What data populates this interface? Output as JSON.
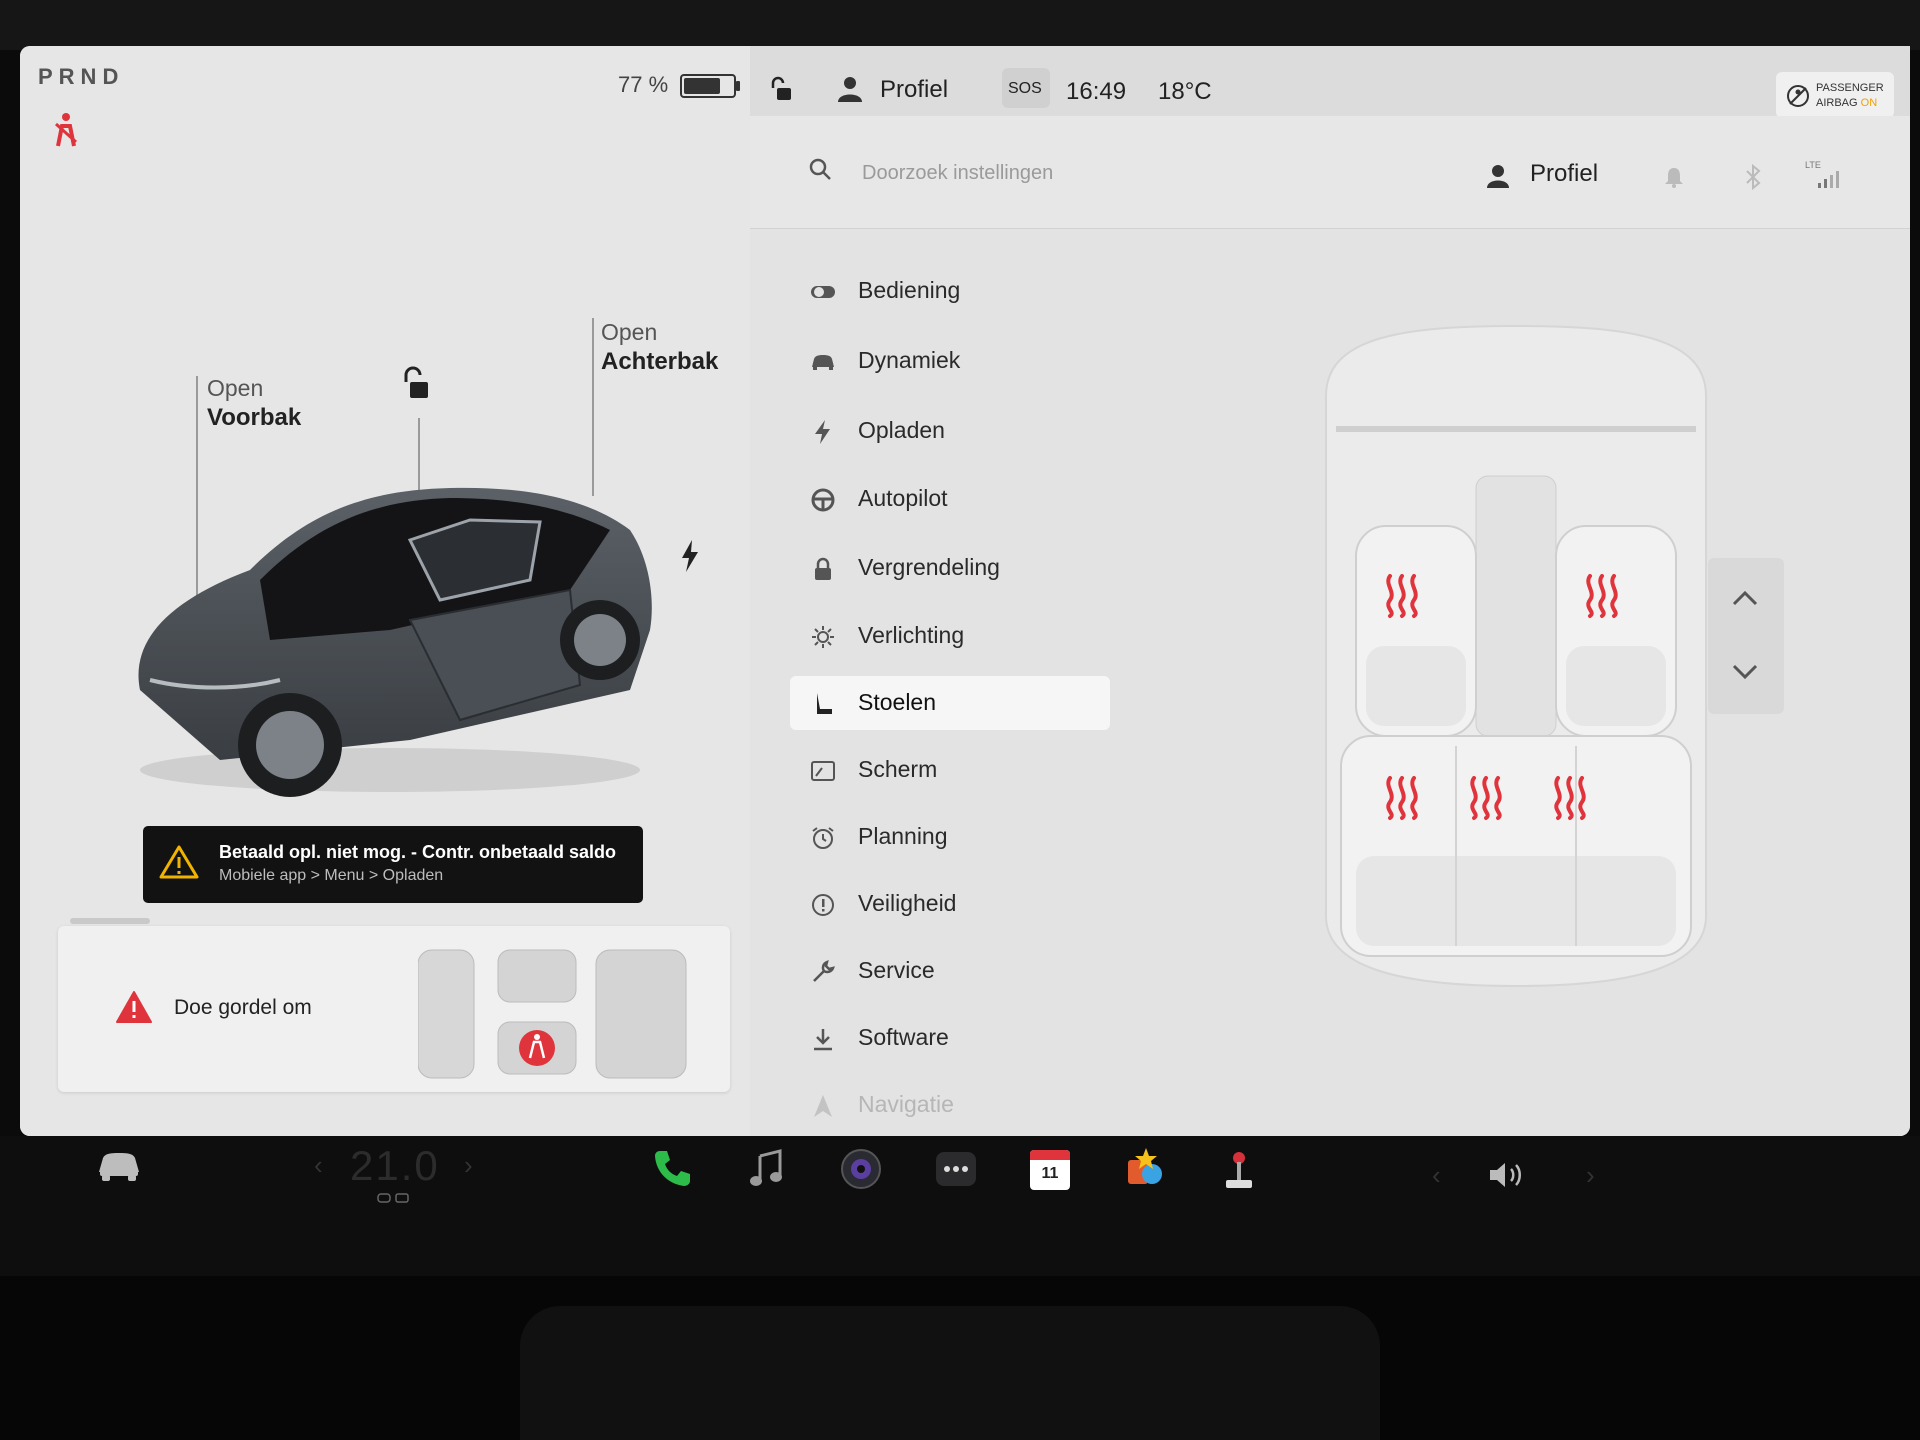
{
  "left": {
    "gear": "PRND",
    "battery": {
      "percent_text": "77 %",
      "level": 0.77
    },
    "frunk": {
      "action": "Open",
      "name": "Voorbak"
    },
    "trunk": {
      "action": "Open",
      "name": "Achterbak"
    },
    "alert": {
      "line1": "Betaald opl. niet mog. - Contr. onbetaald saldo",
      "line2": "Mobiele app > Menu > Opladen"
    },
    "belt_card": {
      "text": "Doe gordel om"
    }
  },
  "statusbar": {
    "profile": "Profiel",
    "sos": "SOS",
    "time": "16:49",
    "temperature": "18°C",
    "airbag_line1": "PASSENGER",
    "airbag_line2": "AIRBAG",
    "airbag_state": "ON"
  },
  "settings": {
    "search_placeholder": "Doorzoek instellingen",
    "profile": "Profiel",
    "lte": "LTE",
    "menu": [
      {
        "label": "Bediening",
        "icon": "toggle-icon"
      },
      {
        "label": "Dynamiek",
        "icon": "car-icon"
      },
      {
        "label": "Opladen",
        "icon": "bolt-icon"
      },
      {
        "label": "Autopilot",
        "icon": "steering-wheel-icon"
      },
      {
        "label": "Vergrendeling",
        "icon": "lock-icon"
      },
      {
        "label": "Verlichting",
        "icon": "sun-icon"
      },
      {
        "label": "Stoelen",
        "icon": "seat-icon",
        "active": true
      },
      {
        "label": "Scherm",
        "icon": "screen-icon"
      },
      {
        "label": "Planning",
        "icon": "alarm-clock-icon"
      },
      {
        "label": "Veiligheid",
        "icon": "info-circle-icon"
      },
      {
        "label": "Service",
        "icon": "wrench-icon"
      },
      {
        "label": "Software",
        "icon": "download-icon"
      },
      {
        "label": "Navigatie",
        "icon": "navigation-icon"
      }
    ],
    "seat_heat_color": "#e0343c"
  },
  "taskbar": {
    "temperature": "21.0",
    "calendar_day": "11"
  }
}
